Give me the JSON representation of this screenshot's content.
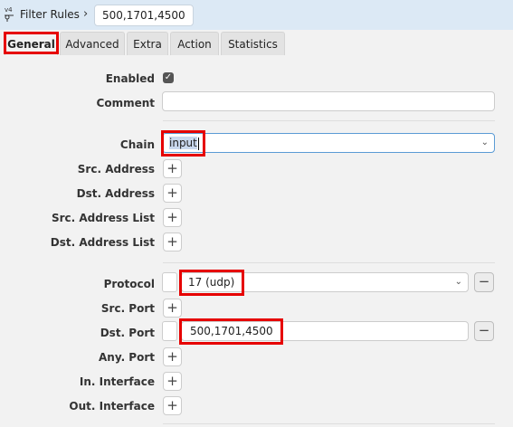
{
  "breadcrumb": {
    "section": "Filter Rules",
    "separator": "›",
    "current": "500,1701,4500"
  },
  "tabs": [
    {
      "label": "General",
      "active": true
    },
    {
      "label": "Advanced",
      "active": false
    },
    {
      "label": "Extra",
      "active": false
    },
    {
      "label": "Action",
      "active": false
    },
    {
      "label": "Statistics",
      "active": false
    }
  ],
  "form": {
    "enabled": {
      "label": "Enabled",
      "checked": true
    },
    "comment": {
      "label": "Comment",
      "value": ""
    },
    "chain": {
      "label": "Chain",
      "value": "input"
    },
    "src_address": {
      "label": "Src. Address"
    },
    "dst_address": {
      "label": "Dst. Address"
    },
    "src_address_list": {
      "label": "Src. Address List"
    },
    "dst_address_list": {
      "label": "Dst. Address List"
    },
    "protocol": {
      "label": "Protocol",
      "value": "17 (udp)"
    },
    "src_port": {
      "label": "Src. Port"
    },
    "dst_port": {
      "label": "Dst. Port",
      "value": "500,1701,4500"
    },
    "any_port": {
      "label": "Any. Port"
    },
    "in_interface": {
      "label": "In. Interface"
    },
    "out_interface": {
      "label": "Out. Interface"
    }
  },
  "icons": {
    "checkmark": "✓",
    "plus": "+",
    "minus": "−",
    "chevron": "⌄"
  },
  "colors": {
    "highlight": "#e60000",
    "topbar": "#dce9f5",
    "background": "#f2f2f2"
  }
}
